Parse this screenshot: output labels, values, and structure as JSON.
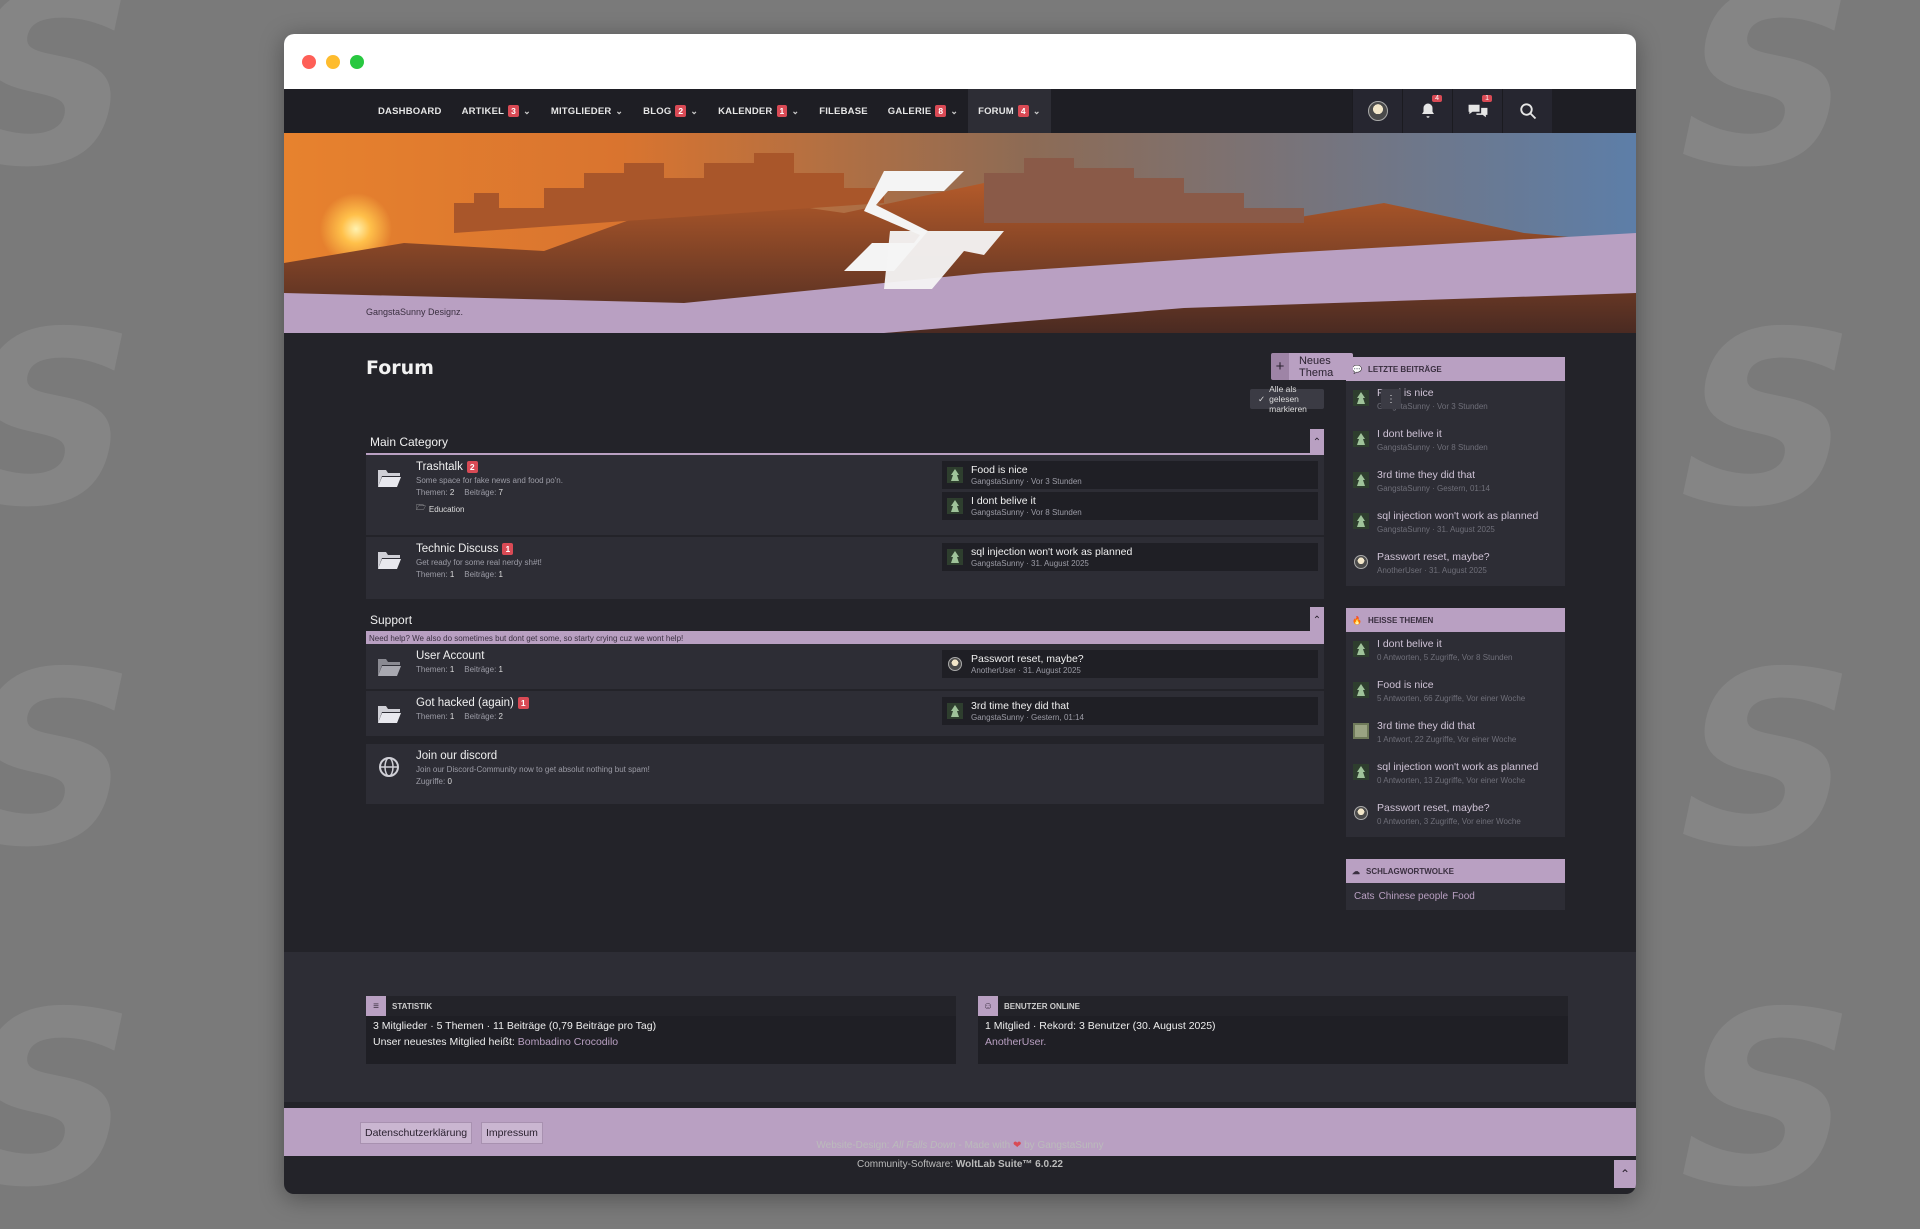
{
  "nav": {
    "items": [
      {
        "label": "Dashboard",
        "badge": "",
        "chevron": ""
      },
      {
        "label": "Artikel",
        "badge": "3",
        "chevron": "⌄"
      },
      {
        "label": "Mitglieder",
        "badge": "",
        "chevron": "⌄"
      },
      {
        "label": "Blog",
        "badge": "2",
        "chevron": "⌄"
      },
      {
        "label": "Kalender",
        "badge": "1",
        "chevron": "⌄"
      },
      {
        "label": "Filebase",
        "badge": "",
        "chevron": ""
      },
      {
        "label": "Galerie",
        "badge": "8",
        "chevron": "⌄"
      },
      {
        "label": "Forum",
        "badge": "4",
        "chevron": "⌄"
      }
    ],
    "notifications_badge": "4",
    "conversations_badge": "1"
  },
  "breadcrumb": "GangstaSunny Designz.",
  "page": {
    "title": "Forum",
    "new_topic_label": "Neues Thema",
    "mark_read_label": "Alle als gelesen markieren"
  },
  "categories": {
    "main": {
      "title": "Main Category",
      "boards": {
        "trashtalk": {
          "name": "Trashtalk",
          "badge": "2",
          "desc": "Some space for fake news and food po'n.",
          "topics_label": "Themen",
          "topics": "2",
          "posts_label": "Beiträge",
          "posts": "7",
          "sub": "Education",
          "last": [
            {
              "title": "Food is nice",
              "meta": "GangstaSunny · Vor 3 Stunden"
            },
            {
              "title": "I dont belive it",
              "meta": "GangstaSunny · Vor 8 Stunden"
            }
          ]
        },
        "technic": {
          "name": "Technic Discuss",
          "badge": "1",
          "desc": "Get ready for some real nerdy sh#t!",
          "topics_label": "Themen",
          "topics": "1",
          "posts_label": "Beiträge",
          "posts": "1",
          "last": [
            {
              "title": "sql injection won't work as planned",
              "meta": "GangstaSunny · 31. August 2025"
            }
          ]
        }
      }
    },
    "support": {
      "title": "Support",
      "desc": "Need help? We also do sometimes but dont get some, so starty crying cuz we wont help!",
      "boards": {
        "account": {
          "name": "User Account",
          "topics_label": "Themen",
          "topics": "1",
          "posts_label": "Beiträge",
          "posts": "1",
          "last": [
            {
              "title": "Passwort reset, maybe?",
              "meta": "AnotherUser · 31. August 2025"
            }
          ]
        },
        "hacked": {
          "name": "Got hacked (again)",
          "badge": "1",
          "topics_label": "Themen",
          "topics": "1",
          "posts_label": "Beiträge",
          "posts": "2",
          "last": [
            {
              "title": "3rd time they did that",
              "meta": "GangstaSunny · Gestern, 01:14"
            }
          ]
        }
      }
    },
    "discord": {
      "name": "Join our discord",
      "desc": "Join our Discord-Community now to get absolut nothing but spam!",
      "hits_label": "Zugriffe",
      "hits": "0"
    }
  },
  "sidebar": {
    "recent": {
      "title": "Letzte Beiträge",
      "items": [
        {
          "title": "Food is nice",
          "meta": "GangstaSunny · Vor 3 Stunden"
        },
        {
          "title": "I dont belive it",
          "meta": "GangstaSunny · Vor 8 Stunden"
        },
        {
          "title": "3rd time they did that",
          "meta": "GangstaSunny · Gestern, 01:14"
        },
        {
          "title": "sql injection won't work as planned",
          "meta": "GangstaSunny · 31. August 2025"
        },
        {
          "title": "Passwort reset, maybe?",
          "meta": "AnotherUser · 31. August 2025"
        }
      ]
    },
    "hot": {
      "title": "Heisse Themen",
      "items": [
        {
          "title": "I dont belive it",
          "meta": "0 Antworten, 5 Zugriffe, Vor 8 Stunden"
        },
        {
          "title": "Food is nice",
          "meta": "5 Antworten, 66 Zugriffe, Vor einer Woche"
        },
        {
          "title": "3rd time they did that",
          "meta": "1 Antwort, 22 Zugriffe, Vor einer Woche"
        },
        {
          "title": "sql injection won't work as planned",
          "meta": "0 Antworten, 13 Zugriffe, Vor einer Woche"
        },
        {
          "title": "Passwort reset, maybe?",
          "meta": "0 Antworten, 3 Zugriffe, Vor einer Woche"
        }
      ]
    },
    "tags": {
      "title": "Schlagwortwolke",
      "items": [
        "Cats",
        "Chinese people",
        "Food"
      ]
    }
  },
  "stats": {
    "title": "Statistik",
    "line1": "3 Mitglieder · 5 Themen · 11 Beiträge (0,79 Beiträge pro Tag)",
    "line2_prefix": "Unser neuestes Mitglied heißt:",
    "newest_member": "Bombadino Crocodilo"
  },
  "online": {
    "title": "Benutzer online",
    "line1": "1 Mitglied · Rekord: 3 Benutzer (30. August 2025)",
    "users": "AnotherUser."
  },
  "footer": {
    "privacy": "Datenschutzerklärung",
    "imprint": "Impressum",
    "design_prefix": "Website-Design:",
    "design_name": "All Falls Down",
    "design_made": "- Made with",
    "design_by": "by GangstaSunny",
    "software_prefix": "Community-Software:",
    "software_name": "WoltLab Suite™ 6.0.22"
  },
  "colors": {
    "accent": "#b9a0c2",
    "badge": "#d94a55",
    "dark": "#232329",
    "panel": "#2d2d35"
  }
}
